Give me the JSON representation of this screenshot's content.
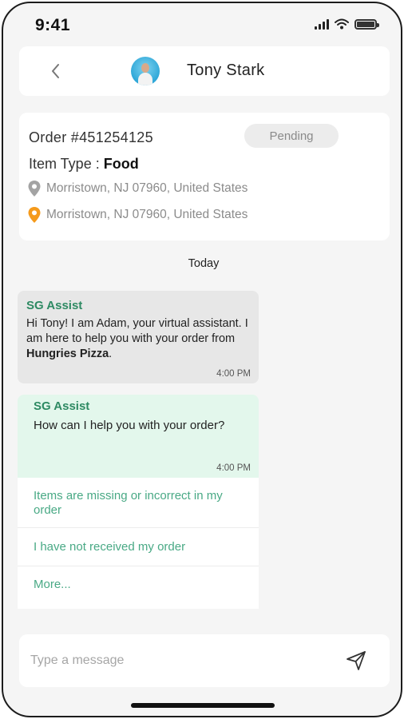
{
  "status_bar": {
    "time": "9:41",
    "icons": [
      "cellular-signal-icon",
      "wifi-icon",
      "battery-icon"
    ]
  },
  "header": {
    "back_icon": "chevron-left-icon",
    "contact_name": "Tony Stark"
  },
  "order": {
    "number_text": "Order #451254125",
    "status": "Pending",
    "item_type_label": "Item Type : ",
    "item_type_value": "Food",
    "pickup_address": "Morristown, NJ 07960, United States",
    "dropoff_address": "Morristown, NJ 07960, United States"
  },
  "chat": {
    "date_label": "Today",
    "messages": [
      {
        "sender": "SG Assist",
        "text_before": "Hi Tony! I am Adam, your virtual assistant. I am here to help you with your order from ",
        "text_bold": "Hungries Pizza",
        "text_after": ".",
        "time": "4:00 PM"
      },
      {
        "sender": "SG Assist",
        "text": "How can I help you with your order?",
        "time": "4:00 PM"
      }
    ],
    "quick_replies": [
      "Items are missing or incorrect in my order",
      "I have not received my order",
      "More..."
    ]
  },
  "composer": {
    "placeholder": "Type a message",
    "send_icon": "send-icon"
  },
  "colors": {
    "accent_green": "#2e8a63",
    "option_green": "#49a985",
    "bubble_green": "#e3f7ec",
    "bubble_gray": "#e7e7e7",
    "pin_gray": "#9a9a9a",
    "pin_orange": "#f59a1b",
    "avatar_blue": "#2ea7d8"
  }
}
